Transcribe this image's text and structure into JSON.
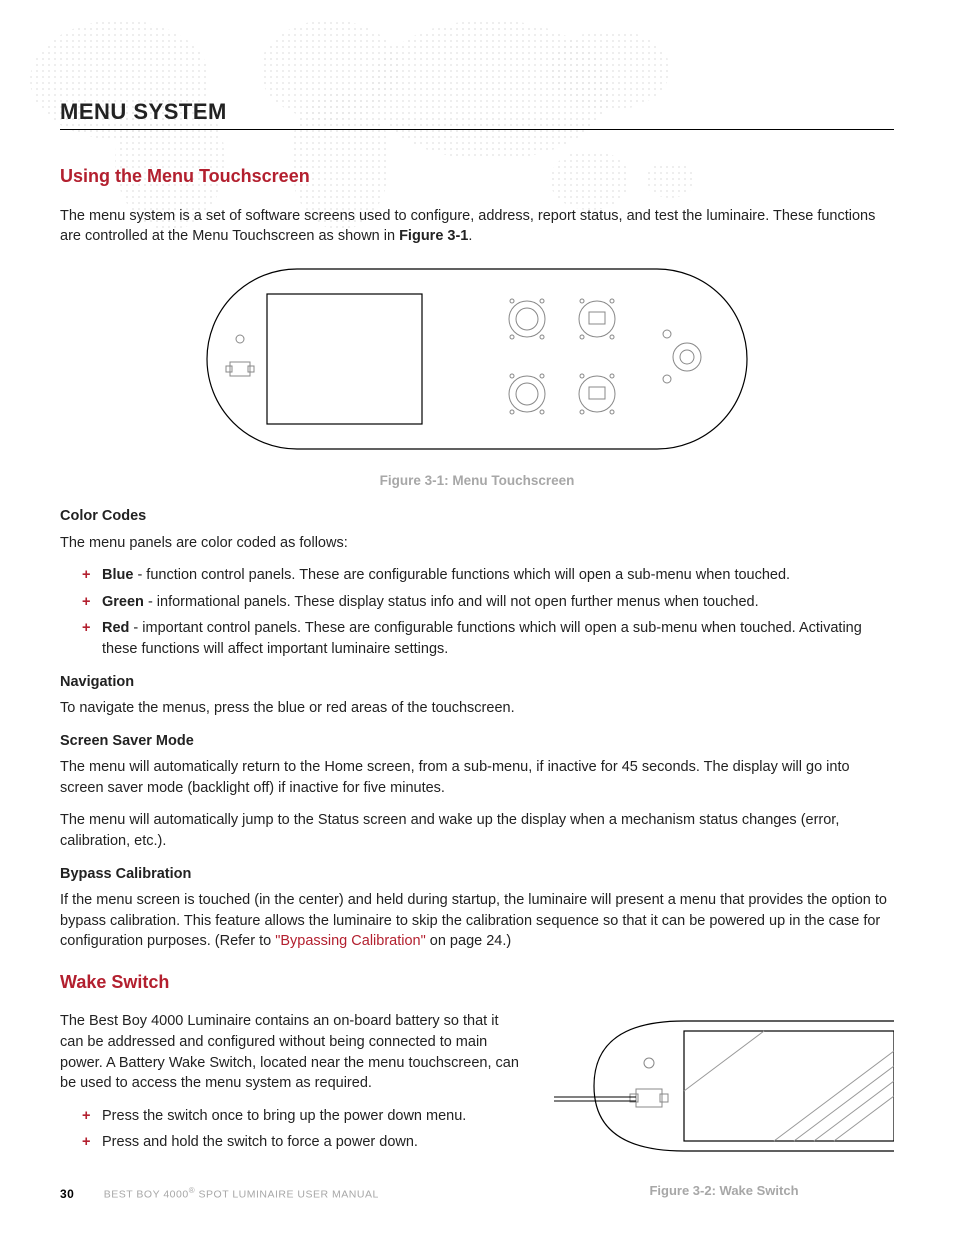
{
  "section_title": "MENU SYSTEM",
  "sub1": {
    "title": "Using the Menu Touchscreen",
    "intro_a": "The menu system is a set of software screens used to configure, address, report status, and test the luminaire. These functions are controlled at the Menu Touchscreen as shown in ",
    "intro_bold": "Figure 3-1",
    "intro_b": ".",
    "fig1_caption": "Figure 3-1:  Menu Touchscreen",
    "color_codes_head": "Color Codes",
    "color_codes_intro": "The menu panels are color coded as follows:",
    "bullets": [
      {
        "lead": "Blue",
        "text": " - function control panels. These are configurable functions which will open a sub-menu when touched."
      },
      {
        "lead": "Green",
        "text": " - informational panels. These display status info and will not open further menus when touched."
      },
      {
        "lead": "Red",
        "text": " - important control panels. These are configurable functions which will open a sub-menu when touched. Activating these functions will affect important luminaire settings."
      }
    ],
    "nav_head": "Navigation",
    "nav_text": "To navigate the menus, press the blue or red areas of the touchscreen.",
    "ss_head": "Screen Saver Mode",
    "ss_p1": "The menu will automatically return to the Home screen, from a sub-menu, if inactive for 45 seconds. The display will go into screen saver mode (backlight off) if inactive for five minutes.",
    "ss_p2": "The menu will automatically jump to the Status screen and wake up the display when a mechanism status changes (error, calibration, etc.).",
    "bypass_head": "Bypass Calibration",
    "bypass_a": "If the menu screen is touched (in the center) and held during startup, the luminaire will present a menu that provides the option to bypass calibration. This feature allows the luminaire to skip the calibration sequence so that it can be powered up in the case for configuration purposes. (Refer to ",
    "bypass_link": "\"Bypassing Calibration\"",
    "bypass_b": " on page 24.)"
  },
  "sub2": {
    "title": "Wake Switch",
    "p1": "The Best Boy 4000 Luminaire contains an on-board battery so that it can be addressed and configured without being connected to main power. A Battery Wake Switch, located near the menu touchscreen, can be used to access the menu system as required.",
    "bullets": [
      "Press the switch once to bring up the power down menu.",
      "Press and hold the switch to force a power down."
    ],
    "fig2_caption": "Figure 3-2:  Wake Switch"
  },
  "footer": {
    "page": "30",
    "book_a": "BEST BOY 4000",
    "book_b": " SPOT LUMINAIRE USER MANUAL"
  }
}
